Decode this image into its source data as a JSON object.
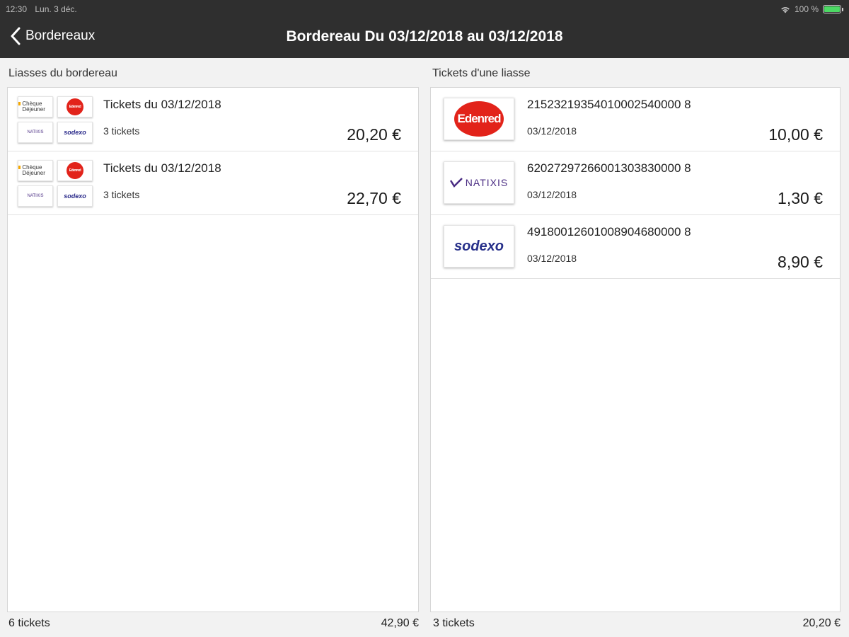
{
  "status_bar": {
    "time": "12:30",
    "date": "Lun. 3 déc.",
    "battery": "100 %",
    "battery_level": 1.0,
    "icons": [
      "wifi-icon",
      "battery-icon"
    ]
  },
  "nav": {
    "back_label": "Bordereaux",
    "title": "Bordereau Du 03/12/2018 au 03/12/2018"
  },
  "left": {
    "label": "Liasses du bordereau",
    "rows": [
      {
        "title": "Tickets du 03/12/2018",
        "count": "3 tickets",
        "amount": "20,20 €"
      },
      {
        "title": "Tickets du 03/12/2018",
        "count": "3 tickets",
        "amount": "22,70 €"
      }
    ],
    "footer_count": "6 tickets",
    "footer_total": "42,90 €"
  },
  "logo_text": {
    "cheque": "Chèque Déjeuner",
    "edenred": "Edenred",
    "natixis": "NATIXIS",
    "sodexo": "sodexo"
  },
  "right": {
    "label": "Tickets d'une liasse",
    "rows": [
      {
        "logo": "edenred",
        "code": "21523219354010002540000 8",
        "date": "03/12/2018",
        "amount": "10,00 €"
      },
      {
        "logo": "natixis",
        "code": "62027297266001303830000 8",
        "date": "03/12/2018",
        "amount": "1,30 €"
      },
      {
        "logo": "sodexo",
        "code": "49180012601008904680000 8",
        "date": "03/12/2018",
        "amount": "8,90 €"
      }
    ],
    "footer_count": "3 tickets",
    "footer_total": "20,20 €"
  },
  "colors": {
    "nav_bg": "#2f2f2f",
    "edenred": "#e2231a",
    "natixis": "#4a2c83",
    "sodexo": "#27308a",
    "battery": "#4cd964"
  }
}
